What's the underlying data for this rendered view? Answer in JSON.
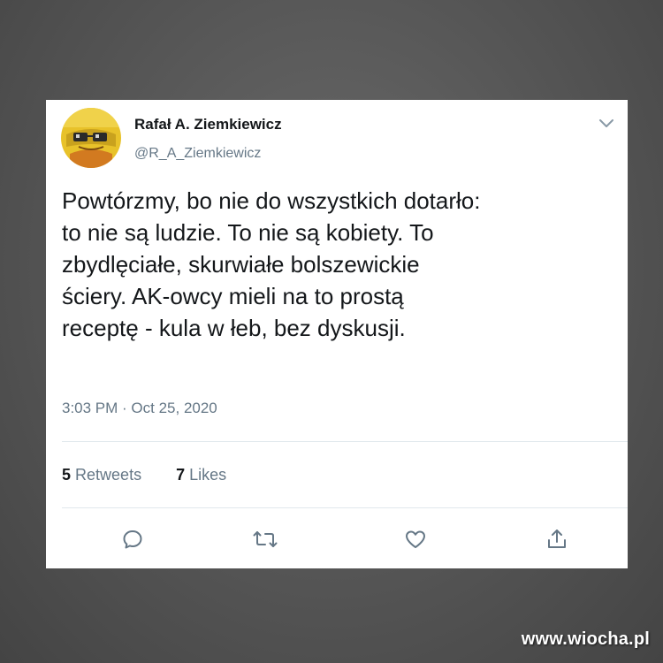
{
  "tweet": {
    "author_name": "Rafał A. Ziemkiewicz",
    "author_handle": "@R_A_Ziemkiewicz",
    "text": "Powtórzmy, bo nie do wszystkich dotarło:\nto nie są ludzie. To nie są kobiety. To\nzbydlęciałe, skurwiałe bolszewickie\nściery. AK-owcy mieli na to prostą\nreceptę - kula w łeb, bez dyskusji.",
    "timestamp": "3:03 PM · Oct 25, 2020",
    "stats": {
      "retweets_count": "5",
      "retweets_label": "Retweets",
      "likes_count": "7",
      "likes_label": "Likes"
    },
    "actions": [
      "reply-icon",
      "retweet-icon",
      "like-icon",
      "share-icon"
    ],
    "colors": {
      "text": "#14171a",
      "secondary": "#657786",
      "divider": "#e1e8ed",
      "card": "#ffffff"
    }
  },
  "watermark": "www.wiocha.pl"
}
